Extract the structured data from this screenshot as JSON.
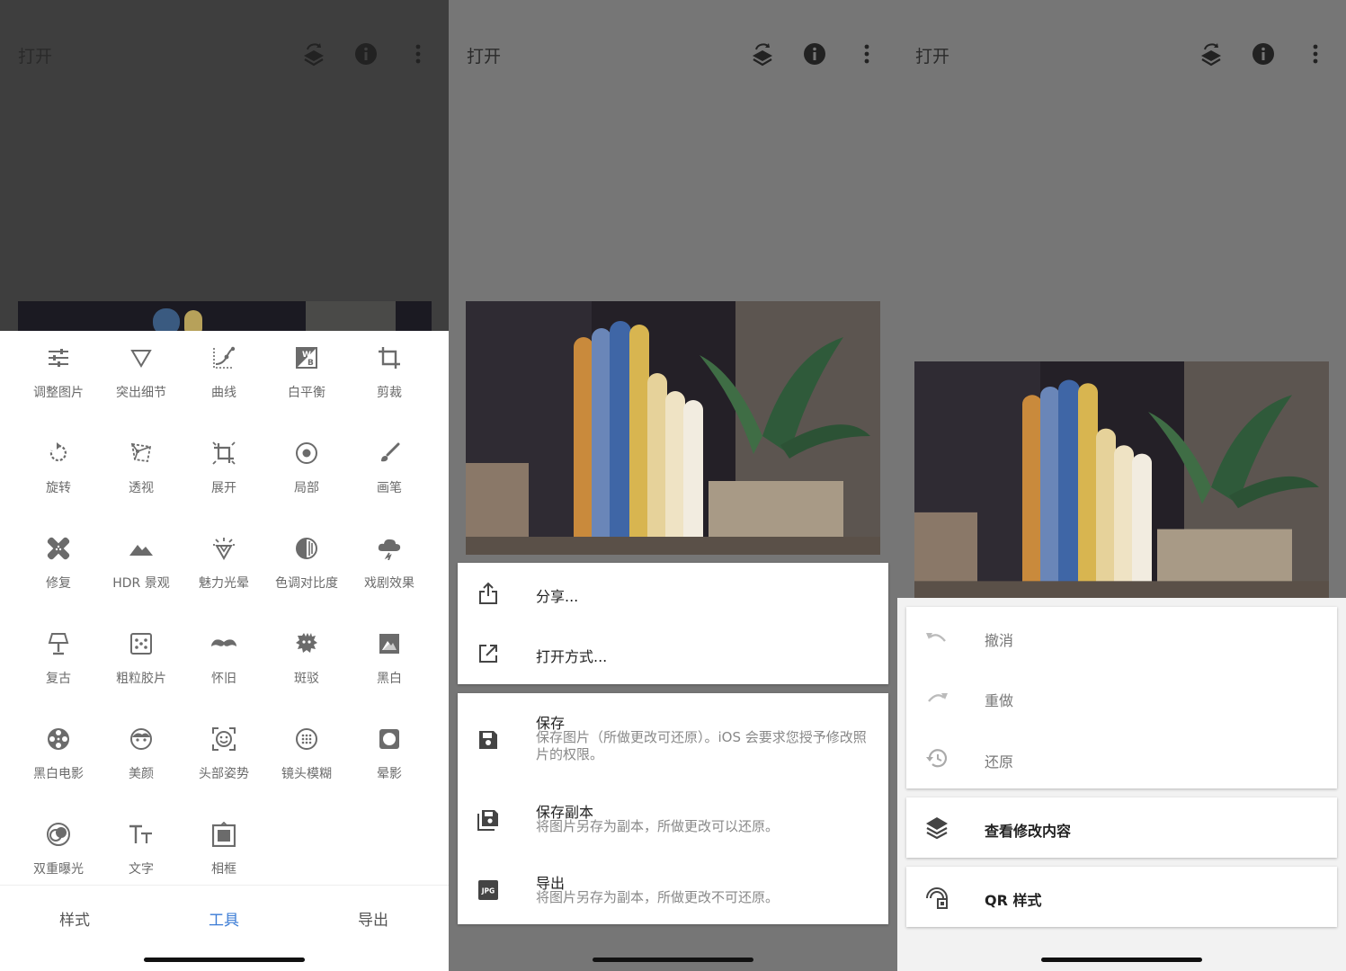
{
  "topbar": {
    "open_label": "打开"
  },
  "tools": [
    {
      "label": "调整图片",
      "icon": "tune-icon"
    },
    {
      "label": "突出细节",
      "icon": "details-icon"
    },
    {
      "label": "曲线",
      "icon": "curves-icon"
    },
    {
      "label": "白平衡",
      "icon": "white-balance-icon"
    },
    {
      "label": "剪裁",
      "icon": "crop-icon"
    },
    {
      "label": "旋转",
      "icon": "rotate-icon"
    },
    {
      "label": "透视",
      "icon": "perspective-icon"
    },
    {
      "label": "展开",
      "icon": "expand-icon"
    },
    {
      "label": "局部",
      "icon": "selective-icon"
    },
    {
      "label": "画笔",
      "icon": "brush-icon"
    },
    {
      "label": "修复",
      "icon": "healing-icon"
    },
    {
      "label": "HDR 景观",
      "icon": "hdr-icon"
    },
    {
      "label": "魅力光晕",
      "icon": "glamour-glow-icon"
    },
    {
      "label": "色调对比度",
      "icon": "tonal-contrast-icon"
    },
    {
      "label": "戏剧效果",
      "icon": "drama-icon"
    },
    {
      "label": "复古",
      "icon": "vintage-icon"
    },
    {
      "label": "粗粒胶片",
      "icon": "grainy-film-icon"
    },
    {
      "label": "怀旧",
      "icon": "retrolux-icon"
    },
    {
      "label": "斑驳",
      "icon": "grunge-icon"
    },
    {
      "label": "黑白",
      "icon": "black-white-icon"
    },
    {
      "label": "黑白电影",
      "icon": "noir-icon"
    },
    {
      "label": "美颜",
      "icon": "face-icon"
    },
    {
      "label": "头部姿势",
      "icon": "head-pose-icon"
    },
    {
      "label": "镜头模糊",
      "icon": "lens-blur-icon"
    },
    {
      "label": "晕影",
      "icon": "vignette-icon"
    },
    {
      "label": "双重曝光",
      "icon": "double-exposure-icon"
    },
    {
      "label": "文字",
      "icon": "text-icon"
    },
    {
      "label": "相框",
      "icon": "frames-icon"
    }
  ],
  "bottom_tabs": [
    {
      "label": "样式",
      "active": false
    },
    {
      "label": "工具",
      "active": true
    },
    {
      "label": "导出",
      "active": false
    }
  ],
  "colors": {
    "accent": "#3a7bd5",
    "icon": "#6b6b6b",
    "sheet": "#ffffff"
  },
  "export_menu": {
    "share": "分享...",
    "open_with": "打开方式...",
    "save": {
      "title": "保存",
      "desc": "保存图片（所做更改可还原）。iOS 会要求您授予修改照片的权限。"
    },
    "save_copy": {
      "title": "保存副本",
      "desc": "将图片另存为副本，所做更改可以还原。"
    },
    "export": {
      "title": "导出",
      "desc": "将图片另存为副本，所做更改不可还原。"
    }
  },
  "edit_menu": {
    "undo": "撤消",
    "redo": "重做",
    "revert": "还原",
    "view_edits": "查看修改内容",
    "qr_look": "QR 样式"
  }
}
